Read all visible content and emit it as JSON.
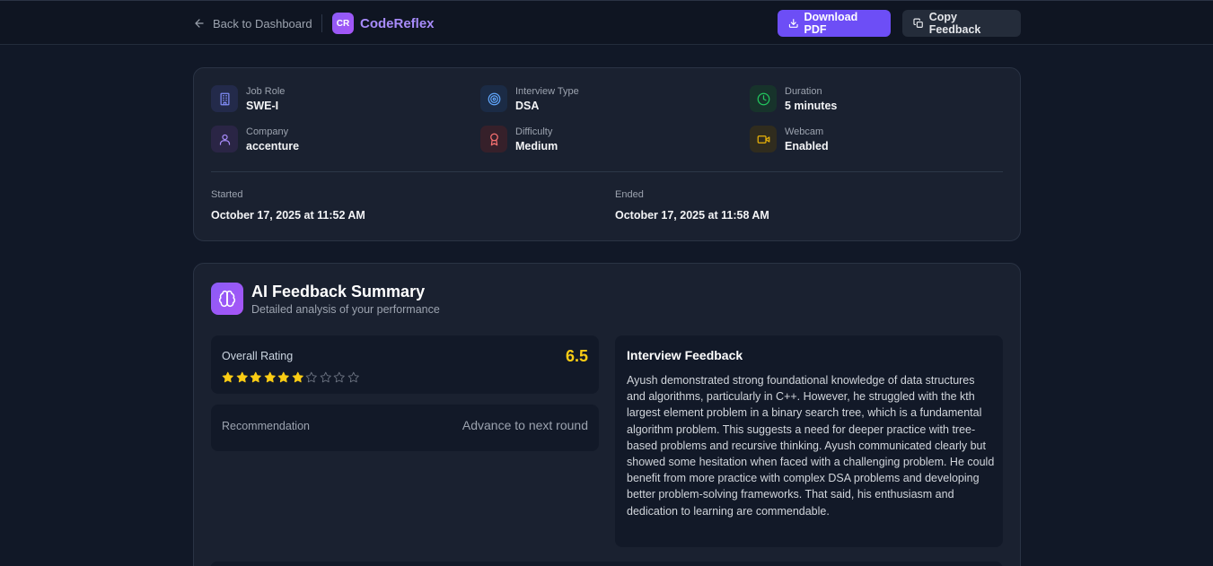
{
  "header": {
    "back_label": "Back to Dashboard",
    "brand_logo": "CR",
    "brand_name": "CodeReflex",
    "download_label": "Download PDF",
    "copy_label": "Copy Feedback"
  },
  "info": {
    "job_role": {
      "label": "Job Role",
      "value": "SWE-I",
      "icon": "building-icon",
      "color": "#818cf8"
    },
    "interview_type": {
      "label": "Interview Type",
      "value": "DSA",
      "icon": "target-icon",
      "color": "#60a5fa"
    },
    "duration": {
      "label": "Duration",
      "value": "5 minutes",
      "icon": "clock-icon",
      "color": "#22c55e"
    },
    "company": {
      "label": "Company",
      "value": "accenture",
      "icon": "user-icon",
      "color": "#a78bfa"
    },
    "difficulty": {
      "label": "Difficulty",
      "value": "Medium",
      "icon": "award-icon",
      "color": "#f87171"
    },
    "webcam": {
      "label": "Webcam",
      "value": "Enabled",
      "icon": "video-icon",
      "color": "#eab308"
    },
    "started_label": "Started",
    "started_value": "October 17, 2025 at 11:52 AM",
    "ended_label": "Ended",
    "ended_value": "October 17, 2025 at 11:58 AM"
  },
  "feedback": {
    "title": "AI Feedback Summary",
    "subtitle": "Detailed analysis of your performance",
    "rating_label": "Overall Rating",
    "rating_value": "6.5",
    "rating_filled_stars": 6,
    "rating_total_stars": 10,
    "recommendation_label": "Recommendation",
    "recommendation_value": "Advance to next round",
    "interview_feedback_title": "Interview Feedback",
    "interview_feedback_text": "Ayush demonstrated strong foundational knowledge of data structures and algorithms, particularly in C++. However, he struggled with the kth largest element problem in a binary search tree, which is a fundamental algorithm problem. This suggests a need for deeper practice with tree-based problems and recursive thinking. Ayush communicated clearly but showed some hesitation when faced with a challenging problem. He could benefit from more practice with complex DSA problems and developing better problem-solving frameworks. That said, his enthusiasm and dedication to learning are commendable.",
    "star_color": "#facc15"
  }
}
